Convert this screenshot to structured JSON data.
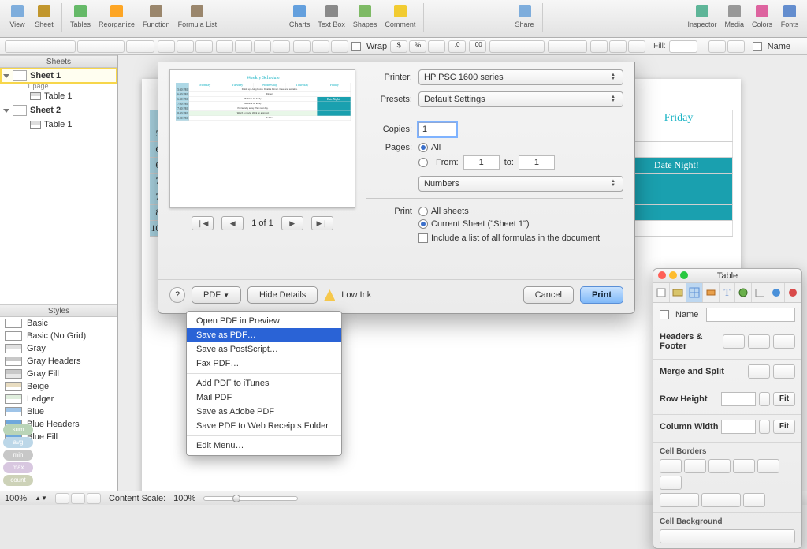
{
  "toolbar": {
    "groups": [
      {
        "icons": [
          "eye"
        ],
        "label": "View"
      },
      {
        "icons": [
          "sheet"
        ],
        "label": "Sheet"
      },
      {
        "icons": [
          "table"
        ],
        "label": "Tables"
      },
      {
        "icons": [
          "reorg"
        ],
        "label": "Reorganize"
      },
      {
        "icons": [
          "fx"
        ],
        "label": "Function"
      },
      {
        "icons": [
          "flist"
        ],
        "label": "Formula List"
      },
      {
        "icons": [
          "chart"
        ],
        "label": "Charts"
      },
      {
        "icons": [
          "textbox"
        ],
        "label": "Text Box"
      },
      {
        "icons": [
          "shapes"
        ],
        "label": "Shapes"
      },
      {
        "icons": [
          "comment"
        ],
        "label": "Comment"
      },
      {
        "icons": [
          "share"
        ],
        "label": "Share"
      },
      {
        "icons": [
          "inspector"
        ],
        "label": "Inspector"
      },
      {
        "icons": [
          "media"
        ],
        "label": "Media"
      },
      {
        "icons": [
          "colors"
        ],
        "label": "Colors"
      },
      {
        "icons": [
          "fonts"
        ],
        "label": "Fonts"
      }
    ]
  },
  "strip": {
    "wrap": "Wrap",
    "name": "Name",
    "fill": "Fill:"
  },
  "sheets_panel": {
    "title": "Sheets",
    "items": [
      {
        "name": "Sheet 1",
        "meta": "1 page",
        "tables": [
          "Table 1"
        ],
        "selected": true
      },
      {
        "name": "Sheet 2",
        "meta": "",
        "tables": [
          "Table 1"
        ],
        "selected": false
      }
    ]
  },
  "styles_panel": {
    "title": "Styles",
    "items": [
      {
        "label": "Basic",
        "c1": "#fff",
        "c2": "#fff"
      },
      {
        "label": "Basic (No Grid)",
        "c1": "#fff",
        "c2": "#fff"
      },
      {
        "label": "Gray",
        "c1": "#e0e0e0",
        "c2": "#fff"
      },
      {
        "label": "Gray Headers",
        "c1": "#c8c8c8",
        "c2": "#fff"
      },
      {
        "label": "Gray Fill",
        "c1": "#c8c8c8",
        "c2": "#e8e8e8"
      },
      {
        "label": "Beige",
        "c1": "#e8dcc0",
        "c2": "#fff"
      },
      {
        "label": "Ledger",
        "c1": "#dfeedd",
        "c2": "#fff"
      },
      {
        "label": "Blue",
        "c1": "#9fc4e8",
        "c2": "#fff"
      },
      {
        "label": "Blue Headers",
        "c1": "#6fa8dc",
        "c2": "#fff"
      },
      {
        "label": "Blue Fill",
        "c1": "#6fa8dc",
        "c2": "#d4e4f4"
      }
    ]
  },
  "quickpills": [
    {
      "label": "sum",
      "bg": "#b9d4b7"
    },
    {
      "label": "avg",
      "bg": "#bcd7e8"
    },
    {
      "label": "min",
      "bg": "#c7c7c7"
    },
    {
      "label": "max",
      "bg": "#d8c7e0"
    },
    {
      "label": "count",
      "bg": "#cdd2b8"
    }
  ],
  "document": {
    "title": "Weekly Schedule",
    "days": [
      "Monday",
      "Tuesday",
      "Wednesday",
      "Thursday",
      "Friday"
    ],
    "rows": [
      {
        "t": "5:30 PM",
        "cells": [
          "Finish up Living Room. Finalize Dinner. Clear and set table."
        ],
        "span": 5
      },
      {
        "t": "6:00 PM",
        "cells": [
          "Dinner!"
        ],
        "span": 5,
        "cls": ""
      },
      {
        "t": "6:30 PM",
        "cells": [
          "Bedtime for Emily"
        ],
        "span": 4,
        "cls": ""
      },
      {
        "t": "7:00 PM",
        "cells": [
          "Bedtime for Emily"
        ],
        "span": 4,
        "cls": ""
      },
      {
        "t": "7:30 PM",
        "cells": [
          "Put laundry away. Plan next day."
        ],
        "span": 4,
        "cls": ""
      },
      {
        "t": "8:00 PM",
        "cells": [
          "Watch a movie, Work on a project"
        ],
        "span": 4,
        "cls": "evening"
      },
      {
        "t": "10:00 PM",
        "cells": [
          "Bedtime"
        ],
        "span": 5,
        "cls": ""
      }
    ],
    "datenight": "Date Night!"
  },
  "status": {
    "zoom": "100%",
    "scale_label": "Content Scale:",
    "scale": "100%"
  },
  "print": {
    "printer_label": "Printer:",
    "printer": "HP PSC 1600 series",
    "presets_label": "Presets:",
    "presets": "Default Settings",
    "copies_label": "Copies:",
    "copies": "1",
    "pages_label": "Pages:",
    "all": "All",
    "from_label": "From:",
    "from": "1",
    "to_label": "to:",
    "to": "1",
    "app_popup": "Numbers",
    "print_section": "Print",
    "all_sheets": "All sheets",
    "current_sheet": "Current Sheet (\"Sheet 1\")",
    "include_formulas": "Include a list of all formulas in the document",
    "page_of": "1 of 1",
    "help": "?",
    "pdf": "PDF",
    "hide_details": "Hide Details",
    "low_ink": "Low Ink",
    "cancel": "Cancel",
    "print_btn": "Print"
  },
  "pdf_menu": {
    "items": [
      "Open PDF in Preview",
      "Save as PDF…",
      "Save as PostScript…",
      "Fax PDF…",
      "-",
      "Add PDF to iTunes",
      "Mail PDF",
      "Save as Adobe PDF",
      "Save PDF to Web Receipts Folder",
      "-",
      "Edit Menu…"
    ],
    "selected": "Save as PDF…"
  },
  "inspector": {
    "title": "Table",
    "name_label": "Name",
    "sections": {
      "headers": "Headers & Footer",
      "merge": "Merge and Split",
      "rowh": "Row Height",
      "colw": "Column Width",
      "fit": "Fit",
      "borders": "Cell Borders",
      "bg": "Cell Background"
    }
  }
}
